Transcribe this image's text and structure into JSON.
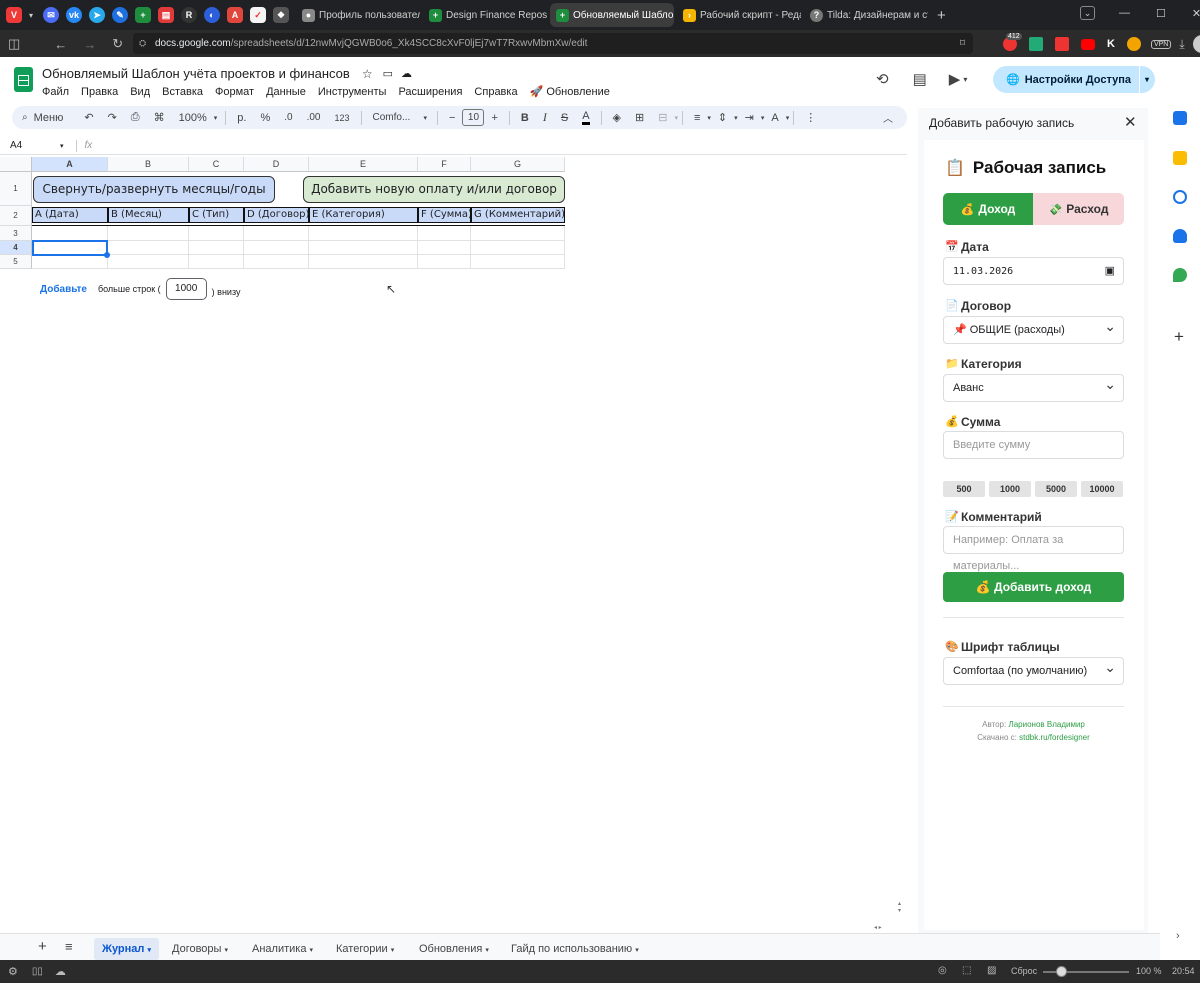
{
  "browser": {
    "tabs": [
      {
        "label": "Профиль пользователя Gi",
        "icon_color": "#888888"
      },
      {
        "label": "Design Finance Repository",
        "icon_color": "#1e8e3e"
      },
      {
        "label": "Обновляемый Шаблон уч",
        "icon_color": "#1e8e3e"
      },
      {
        "label": "Рабочий скрипт - Редакто",
        "icon_color": "#f4b400"
      },
      {
        "label": "Tilda: Дизайнерам и студ",
        "icon_color": "#777777"
      }
    ],
    "url_host": "docs.google.com",
    "url_path": "/spreadsheets/d/12nwMvjQGWB0o6_Xk4SCC8cXvF0ljEj7wT7RxwvMbmXw/edit",
    "badge_count": "412",
    "vpn_label": "VPN"
  },
  "doc": {
    "title": "Обновляемый Шаблон учёта проектов и финансов",
    "menu": [
      "Файл",
      "Правка",
      "Вид",
      "Вставка",
      "Формат",
      "Данные",
      "Инструменты",
      "Расширения",
      "Справка",
      "🚀 Обновление"
    ],
    "share_label": "Настройки Доступа",
    "avatar_letter": "A"
  },
  "toolbar": {
    "search_label": "Меню",
    "zoom": "100%",
    "currency": "р.",
    "percent": "%",
    "dec_less": ".0",
    "dec_more": ".00",
    "format_123": "123",
    "font": "Comfo...",
    "font_size": "10",
    "bold": "B",
    "italic": "I",
    "strike": "S",
    "text_color": "A"
  },
  "formula_bar": {
    "cell_ref": "A4",
    "fx": "fx",
    "value": ""
  },
  "grid": {
    "columns": [
      "A",
      "B",
      "C",
      "D",
      "E",
      "F",
      "G"
    ],
    "rows": [
      "1",
      "2",
      "3",
      "4",
      "5"
    ],
    "button_toggle": "Свернуть/развернуть месяцы/годы",
    "button_add": "Добавить новую оплату и/или договор",
    "headers": [
      "A (Дата)",
      "B (Месяц)",
      "C (Тип)",
      "D (Договор)",
      "E (Категория)",
      "F (Сумма)",
      "G (Комментарий)"
    ],
    "add_rows_link": "Добавьте",
    "add_rows_text": "больше строк (",
    "add_rows_count": "1000",
    "add_rows_suffix": ") внизу"
  },
  "panel": {
    "header": "Добавить рабочую запись",
    "title": "Рабочая запись",
    "income_tab": "Доход",
    "expense_tab": "Расход",
    "date_label": "Дата",
    "date_value": "11.03.2026",
    "contract_label": "Договор",
    "contract_value": "📌 ОБЩИЕ (расходы)",
    "category_label": "Категория",
    "category_value": "Аванс",
    "amount_label": "Сумма",
    "amount_placeholder": "Введите сумму",
    "quick_amounts": [
      "500",
      "1000",
      "5000",
      "10000"
    ],
    "comment_label": "Комментарий",
    "comment_placeholder": "Например: Оплата за материалы...",
    "submit_label": "💰 Добавить доход",
    "font_label": "Шрифт таблицы",
    "font_value": "Comfortaa (по умолчанию)",
    "author_prefix": "Автор:",
    "author_name": "Ларионов Владимир",
    "download_prefix": "Скачано с:",
    "download_site": "stdbk.ru/fordesigner"
  },
  "sheets": [
    "Журнал",
    "Договоры",
    "Аналитика",
    "Категории",
    "Обновления",
    "Гайд по использованию"
  ],
  "status": {
    "reset": "Сброс",
    "zoom": "100 %",
    "time": "20:54"
  }
}
